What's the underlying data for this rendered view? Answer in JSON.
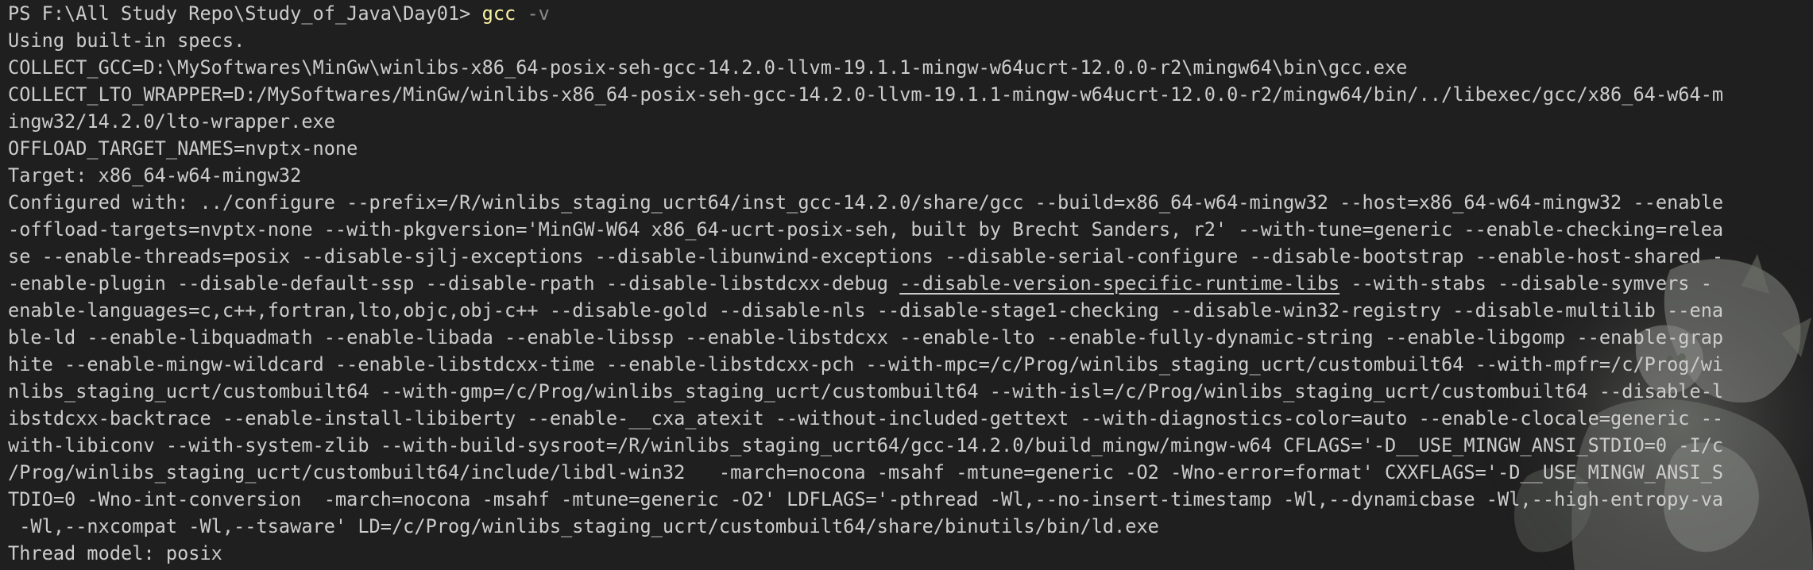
{
  "prompt": {
    "path": "PS F:\\All Study Repo\\Study_of_Java\\Day01> ",
    "command": "gcc",
    "space": " ",
    "flag": "-v"
  },
  "output": {
    "l1": "Using built-in specs.",
    "l2": "COLLECT_GCC=D:\\MySoftwares\\MinGw\\winlibs-x86_64-posix-seh-gcc-14.2.0-llvm-19.1.1-mingw-w64ucrt-12.0.0-r2\\mingw64\\bin\\gcc.exe",
    "l3": "COLLECT_LTO_WRAPPER=D:/MySoftwares/MinGw/winlibs-x86_64-posix-seh-gcc-14.2.0-llvm-19.1.1-mingw-w64ucrt-12.0.0-r2/mingw64/bin/../libexec/gcc/x86_64-w64-m",
    "l4": "ingw32/14.2.0/lto-wrapper.exe",
    "l5": "OFFLOAD_TARGET_NAMES=nvptx-none",
    "l6": "Target: x86_64-w64-mingw32",
    "l7": "Configured with: ../configure --prefix=/R/winlibs_staging_ucrt64/inst_gcc-14.2.0/share/gcc --build=x86_64-w64-mingw32 --host=x86_64-w64-mingw32 --enable",
    "l8": "-offload-targets=nvptx-none --with-pkgversion='MinGW-W64 x86_64-ucrt-posix-seh, built by Brecht Sanders, r2' --with-tune=generic --enable-checking=relea",
    "l9": "se --enable-threads=posix --disable-sjlj-exceptions --disable-libunwind-exceptions --disable-serial-configure --disable-bootstrap --enable-host-shared -",
    "l10a": "-enable-plugin --disable-default-ssp --disable-rpath --disable-libstdcxx-debug ",
    "l10b": "--disable-version-specific-runtime-libs",
    "l10c": " --with-stabs --disable-symvers -",
    "l11": "enable-languages=c,c++,fortran,lto,objc,obj-c++ --disable-gold --disable-nls --disable-stage1-checking --disable-win32-registry --disable-multilib --ena",
    "l12": "ble-ld --enable-libquadmath --enable-libada --enable-libssp --enable-libstdcxx --enable-lto --enable-fully-dynamic-string --enable-libgomp --enable-grap",
    "l13": "hite --enable-mingw-wildcard --enable-libstdcxx-time --enable-libstdcxx-pch --with-mpc=/c/Prog/winlibs_staging_ucrt/custombuilt64 --with-mpfr=/c/Prog/wi",
    "l14": "nlibs_staging_ucrt/custombuilt64 --with-gmp=/c/Prog/winlibs_staging_ucrt/custombuilt64 --with-isl=/c/Prog/winlibs_staging_ucrt/custombuilt64 --disable-l",
    "l15": "ibstdcxx-backtrace --enable-install-libiberty --enable-__cxa_atexit --without-included-gettext --with-diagnostics-color=auto --enable-clocale=generic --",
    "l16": "with-libiconv --with-system-zlib --with-build-sysroot=/R/winlibs_staging_ucrt64/gcc-14.2.0/build_mingw/mingw-w64 CFLAGS='-D__USE_MINGW_ANSI_STDIO=0 -I/c",
    "l17": "/Prog/winlibs_staging_ucrt/custombuilt64/include/libdl-win32   -march=nocona -msahf -mtune=generic -O2 -Wno-error=format' CXXFLAGS='-D__USE_MINGW_ANSI_S",
    "l18": "TDIO=0 -Wno-int-conversion  -march=nocona -msahf -mtune=generic -O2' LDFLAGS='-pthread -Wl,--no-insert-timestamp -Wl,--dynamicbase -Wl,--high-entropy-va",
    "l19": " -Wl,--nxcompat -Wl,--tsaware' LD=/c/Prog/winlibs_staging_ucrt/custombuilt64/share/binutils/bin/ld.exe",
    "l20": "Thread model: posix"
  },
  "colors": {
    "background": "#1f1f1f",
    "text": "#cccccc",
    "command": "#f9f1a5",
    "flag": "#8a8a8a"
  },
  "background_image": "anime-character-watermark"
}
